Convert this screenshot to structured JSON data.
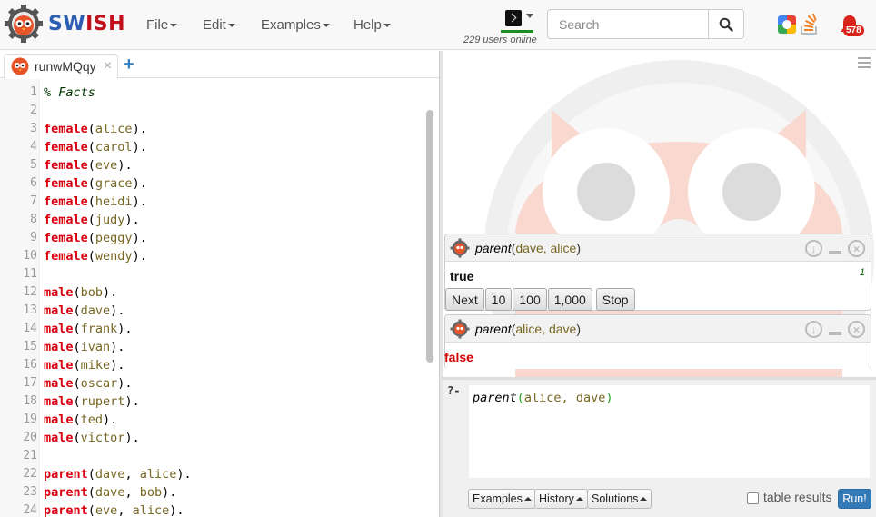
{
  "app": {
    "brand_sw": "SW",
    "brand_ish": "ISH",
    "users_online": "229 users online",
    "notification_count": "578"
  },
  "menu": {
    "file": "File",
    "edit": "Edit",
    "examples": "Examples",
    "help": "Help"
  },
  "search": {
    "placeholder": "Search"
  },
  "tab": {
    "label": "runwMQqy",
    "close": "×",
    "add": "+"
  },
  "editor": {
    "lines": [
      {
        "n": "1",
        "parts": [
          {
            "t": "% Facts",
            "c": "cmt"
          }
        ]
      },
      {
        "n": "2",
        "parts": []
      },
      {
        "n": "3",
        "parts": [
          {
            "t": "female",
            "c": "pred"
          },
          {
            "t": "(",
            "c": ""
          },
          {
            "t": "alice",
            "c": "atom"
          },
          {
            "t": ").",
            "c": ""
          }
        ]
      },
      {
        "n": "4",
        "parts": [
          {
            "t": "female",
            "c": "pred"
          },
          {
            "t": "(",
            "c": ""
          },
          {
            "t": "carol",
            "c": "atom"
          },
          {
            "t": ").",
            "c": ""
          }
        ]
      },
      {
        "n": "5",
        "parts": [
          {
            "t": "female",
            "c": "pred"
          },
          {
            "t": "(",
            "c": ""
          },
          {
            "t": "eve",
            "c": "atom"
          },
          {
            "t": ").",
            "c": ""
          }
        ]
      },
      {
        "n": "6",
        "parts": [
          {
            "t": "female",
            "c": "pred"
          },
          {
            "t": "(",
            "c": ""
          },
          {
            "t": "grace",
            "c": "atom"
          },
          {
            "t": ").",
            "c": ""
          }
        ]
      },
      {
        "n": "7",
        "parts": [
          {
            "t": "female",
            "c": "pred"
          },
          {
            "t": "(",
            "c": ""
          },
          {
            "t": "heidi",
            "c": "atom"
          },
          {
            "t": ").",
            "c": ""
          }
        ]
      },
      {
        "n": "8",
        "parts": [
          {
            "t": "female",
            "c": "pred"
          },
          {
            "t": "(",
            "c": ""
          },
          {
            "t": "judy",
            "c": "atom"
          },
          {
            "t": ").",
            "c": ""
          }
        ]
      },
      {
        "n": "9",
        "parts": [
          {
            "t": "female",
            "c": "pred"
          },
          {
            "t": "(",
            "c": ""
          },
          {
            "t": "peggy",
            "c": "atom"
          },
          {
            "t": ").",
            "c": ""
          }
        ]
      },
      {
        "n": "10",
        "parts": [
          {
            "t": "female",
            "c": "pred"
          },
          {
            "t": "(",
            "c": ""
          },
          {
            "t": "wendy",
            "c": "atom"
          },
          {
            "t": ").",
            "c": ""
          }
        ]
      },
      {
        "n": "11",
        "parts": []
      },
      {
        "n": "12",
        "parts": [
          {
            "t": "male",
            "c": "pred"
          },
          {
            "t": "(",
            "c": ""
          },
          {
            "t": "bob",
            "c": "atom"
          },
          {
            "t": ").",
            "c": ""
          }
        ]
      },
      {
        "n": "13",
        "parts": [
          {
            "t": "male",
            "c": "pred"
          },
          {
            "t": "(",
            "c": ""
          },
          {
            "t": "dave",
            "c": "atom"
          },
          {
            "t": ").",
            "c": ""
          }
        ]
      },
      {
        "n": "14",
        "parts": [
          {
            "t": "male",
            "c": "pred"
          },
          {
            "t": "(",
            "c": ""
          },
          {
            "t": "frank",
            "c": "atom"
          },
          {
            "t": ").",
            "c": ""
          }
        ]
      },
      {
        "n": "15",
        "parts": [
          {
            "t": "male",
            "c": "pred"
          },
          {
            "t": "(",
            "c": ""
          },
          {
            "t": "ivan",
            "c": "atom"
          },
          {
            "t": ").",
            "c": ""
          }
        ]
      },
      {
        "n": "16",
        "parts": [
          {
            "t": "male",
            "c": "pred"
          },
          {
            "t": "(",
            "c": ""
          },
          {
            "t": "mike",
            "c": "atom"
          },
          {
            "t": ").",
            "c": ""
          }
        ]
      },
      {
        "n": "17",
        "parts": [
          {
            "t": "male",
            "c": "pred"
          },
          {
            "t": "(",
            "c": ""
          },
          {
            "t": "oscar",
            "c": "atom"
          },
          {
            "t": ").",
            "c": ""
          }
        ]
      },
      {
        "n": "18",
        "parts": [
          {
            "t": "male",
            "c": "pred"
          },
          {
            "t": "(",
            "c": ""
          },
          {
            "t": "rupert",
            "c": "atom"
          },
          {
            "t": ").",
            "c": ""
          }
        ]
      },
      {
        "n": "19",
        "parts": [
          {
            "t": "male",
            "c": "pred"
          },
          {
            "t": "(",
            "c": ""
          },
          {
            "t": "ted",
            "c": "atom"
          },
          {
            "t": ").",
            "c": ""
          }
        ]
      },
      {
        "n": "20",
        "parts": [
          {
            "t": "male",
            "c": "pred"
          },
          {
            "t": "(",
            "c": ""
          },
          {
            "t": "victor",
            "c": "atom"
          },
          {
            "t": ").",
            "c": ""
          }
        ]
      },
      {
        "n": "21",
        "parts": []
      },
      {
        "n": "22",
        "parts": [
          {
            "t": "parent",
            "c": "pred"
          },
          {
            "t": "(",
            "c": ""
          },
          {
            "t": "dave",
            "c": "atom"
          },
          {
            "t": ", ",
            "c": ""
          },
          {
            "t": "alice",
            "c": "atom"
          },
          {
            "t": ").",
            "c": ""
          }
        ]
      },
      {
        "n": "23",
        "parts": [
          {
            "t": "parent",
            "c": "pred"
          },
          {
            "t": "(",
            "c": ""
          },
          {
            "t": "dave",
            "c": "atom"
          },
          {
            "t": ", ",
            "c": ""
          },
          {
            "t": "bob",
            "c": "atom"
          },
          {
            "t": ").",
            "c": ""
          }
        ]
      },
      {
        "n": "24",
        "parts": [
          {
            "t": "parent",
            "c": "pred"
          },
          {
            "t": "(",
            "c": ""
          },
          {
            "t": "eve",
            "c": "atom"
          },
          {
            "t": ", ",
            "c": ""
          },
          {
            "t": "alice",
            "c": "atom"
          },
          {
            "t": ").",
            "c": ""
          }
        ]
      }
    ]
  },
  "answers": [
    {
      "pred": "parent",
      "args": "dave, alice",
      "result": "true",
      "count": "1",
      "buttons": [
        "Next",
        "10",
        "100",
        "1,000",
        "Stop"
      ]
    },
    {
      "pred": "parent",
      "args": "alice, dave",
      "result": "false"
    }
  ],
  "query": {
    "prompt": "?-",
    "pred": "parent",
    "open": "(",
    "args": "alice, dave",
    "close": ")",
    "examples_label": "Examples",
    "history_label": "History",
    "solutions_label": "Solutions",
    "table_results_label": "table results",
    "run_label": "Run!"
  },
  "colors": {
    "brand_blue": "#2c5fb4",
    "brand_red": "#c0101c",
    "predicate_red": "#d9000e",
    "atom_brown": "#776622",
    "run_blue": "#337ab7",
    "online_green": "#1f8c1f"
  }
}
